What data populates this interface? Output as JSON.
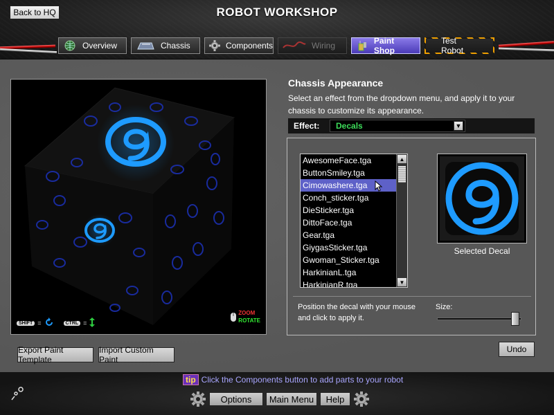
{
  "header": {
    "back_label": "Back to HQ",
    "title": "ROBOT WORKSHOP",
    "tabs": [
      {
        "label": "Overview",
        "icon": "globe-icon",
        "state": "normal"
      },
      {
        "label": "Chassis",
        "icon": "chassis-icon",
        "state": "normal"
      },
      {
        "label": "Components",
        "icon": "gear-icon",
        "state": "normal"
      },
      {
        "label": "Wiring",
        "icon": "wire-icon",
        "state": "disabled"
      },
      {
        "label": "Paint Shop",
        "icon": "paint-can-icon",
        "state": "active"
      },
      {
        "label": "Test Robot",
        "icon": "",
        "state": "hazard"
      }
    ]
  },
  "viewport": {
    "shift_key": "SHIFT",
    "ctrl_key": "CTRL",
    "equals": "=",
    "zoom_label": "ZOOM",
    "rotate_label": "ROTATE"
  },
  "buttons": {
    "export": "Export Paint Template",
    "import": "Import Custom Paint",
    "undo": "Undo"
  },
  "appearance": {
    "title": "Chassis Appearance",
    "description": "Select an effect from the dropdown menu, and apply it to your chassis to customize its appearance.",
    "effect_label": "Effect:",
    "effect_value": "Decals",
    "decals": [
      "AwesomeFace.tga",
      "ButtonSmiley.tga",
      "Cimowashere.tga",
      "Conch_sticker.tga",
      "DieSticker.tga",
      "DittoFace.tga",
      "Gear.tga",
      "GiygasSticker.tga",
      "Gwoman_Sticker.tga",
      "HarkinianL.tga",
      "HarkinianR.tga"
    ],
    "selected_index": 2,
    "selected_label": "Selected Decal",
    "position_hint": "Position the decal with your mouse and click to apply it.",
    "size_label": "Size:",
    "size_level": 0.97
  },
  "bottom": {
    "tip_badge": "tip",
    "tip_text": "Click the Components button to add parts to your robot",
    "options": "Options",
    "main_menu": "Main Menu",
    "help": "Help"
  },
  "colors": {
    "accent_blue": "#1e9bff",
    "active_tab": "#5e4fd0",
    "effect_green": "#3ddc5a",
    "selection": "#5e61c8"
  }
}
